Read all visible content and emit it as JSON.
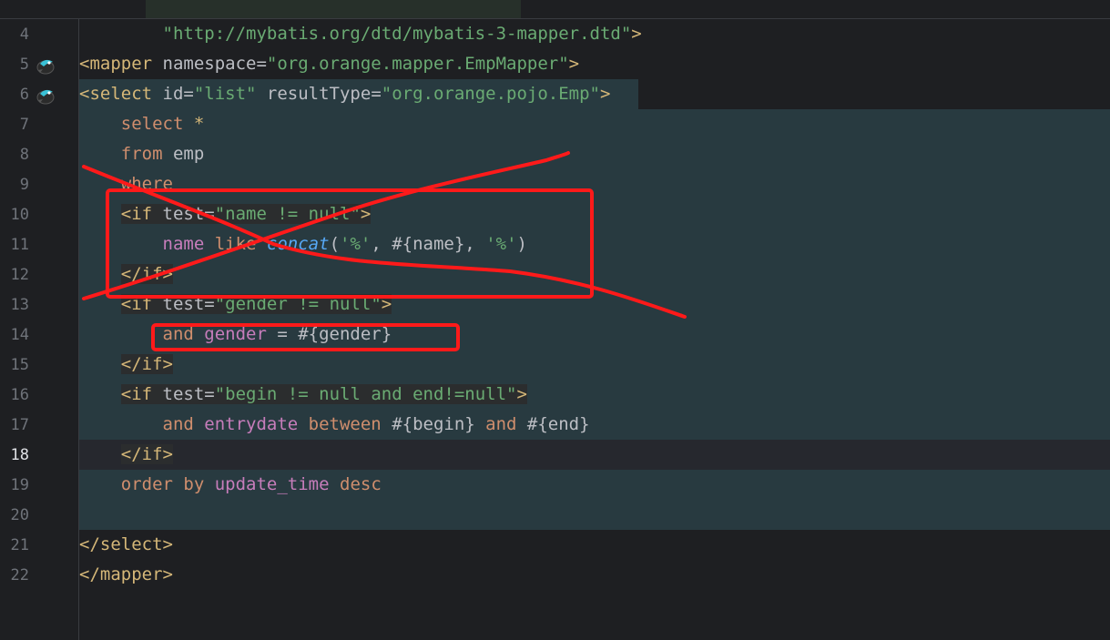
{
  "gutter": {
    "line_numbers": [
      "4",
      "5",
      "6",
      "7",
      "8",
      "9",
      "10",
      "11",
      "12",
      "13",
      "14",
      "15",
      "16",
      "17",
      "18",
      "19",
      "20",
      "21",
      "22"
    ],
    "current_line": "18"
  },
  "code": {
    "l4": {
      "indent": "        ",
      "str": "\"http://mybatis.org/dtd/mybatis-3-mapper.dtd\"",
      "close": ">"
    },
    "l5": {
      "open": "<mapper",
      "attr": " namespace=",
      "str": "\"org.orange.mapper.EmpMapper\"",
      "close": ">"
    },
    "l6": {
      "open": "<select",
      "attr1": " id=",
      "str1": "\"list\"",
      "attr2": " resultType=",
      "str2": "\"org.orange.pojo.Emp\"",
      "close": ">"
    },
    "l7": {
      "indent": "    ",
      "kw": "select",
      "rest": " *"
    },
    "l8": {
      "indent": "    ",
      "kw": "from",
      "rest": " emp"
    },
    "l9": {
      "indent": "    ",
      "kw": "where"
    },
    "l10": {
      "indent": "    ",
      "open": "<if",
      "attr": " test=",
      "str": "\"name != null\"",
      "close": ">"
    },
    "l11": {
      "indent": "        ",
      "col": "name",
      "kw": " like ",
      "fn": "concat",
      "p1": "(",
      "s1": "'%'",
      "c1": ", #{name}, ",
      "s2": "'%'",
      "p2": ")"
    },
    "l12": {
      "indent": "    ",
      "close": "</if>"
    },
    "l13": {
      "indent": "    ",
      "open": "<if",
      "attr": " test=",
      "str": "\"gender != null\"",
      "close": ">"
    },
    "l14": {
      "indent": "        ",
      "kw": "and",
      "col": " gender",
      "rest": " = #{gender}"
    },
    "l15": {
      "indent": "    ",
      "close": "</if>"
    },
    "l16": {
      "indent": "    ",
      "open": "<if",
      "attr": " test=",
      "str": "\"begin != null and end!=null\"",
      "close": ">"
    },
    "l17": {
      "indent": "        ",
      "kw": "and",
      "col": " entrydate",
      "kw2": " between",
      "rest": " #{begin} ",
      "kw3": "and",
      "rest2": " #{end}"
    },
    "l18": {
      "indent": "    ",
      "close": "</if>"
    },
    "l19": {
      "indent": "    ",
      "kw": "order by",
      "col": " update_time",
      "kw2": " desc"
    },
    "l21": {
      "close": "</select>"
    },
    "l22": {
      "close": "</mapper>"
    }
  },
  "icons": {
    "gutter_line5": "mybatis-bird-icon",
    "gutter_line6": "mybatis-bird-icon",
    "gutter_line17": "lightbulb-icon"
  },
  "colors": {
    "background": "#1e1f22",
    "selection": "#283a40",
    "tag": "#d5b778",
    "string": "#6aab73",
    "keyword": "#cf8e6d",
    "column": "#c77dbb",
    "function": "#56a8f5",
    "annotation": "#ff1a1a"
  }
}
